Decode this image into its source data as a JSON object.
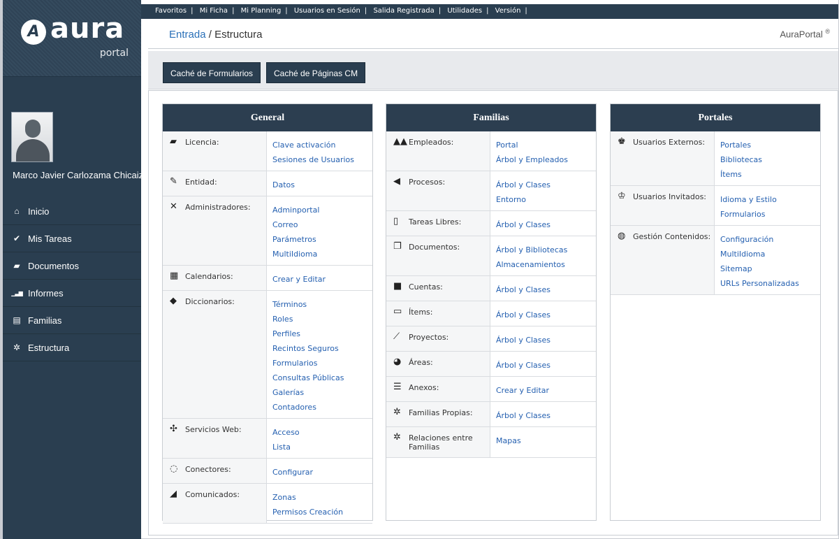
{
  "logo": {
    "mark": "A",
    "word": "aura",
    "sub": "portal"
  },
  "user": {
    "name": "Marco Javier Carlozama Chicaiza"
  },
  "nav": [
    {
      "icon": "home-icon",
      "glyph": "⌂",
      "label": "Inicio"
    },
    {
      "icon": "check-icon",
      "glyph": "✔",
      "label": "Mis Tareas"
    },
    {
      "icon": "folder-icon",
      "glyph": "▰",
      "label": "Documentos"
    },
    {
      "icon": "bar-chart-icon",
      "glyph": "▁▃▆",
      "label": "Informes"
    },
    {
      "icon": "list-icon",
      "glyph": "▤",
      "label": "Familias"
    },
    {
      "icon": "gear-icon",
      "glyph": "✲",
      "label": "Estructura"
    }
  ],
  "topbar": [
    "Favoritos",
    "Mi Ficha",
    "Mi Planning",
    "Usuarios en Sesión",
    "Salida Registrada",
    "Utilidades",
    "Versión"
  ],
  "breadcrumb": {
    "root": "Entrada",
    "sep": " / ",
    "current": "Estructura"
  },
  "brand": {
    "name": "AuraPortal",
    "mark": "®"
  },
  "toolbar": {
    "btn1": "Caché de Formularios",
    "btn2": "Caché de Páginas CM"
  },
  "panels": {
    "general": {
      "title": "General",
      "rows": [
        {
          "icon": "lock-icon",
          "glyph": "▰",
          "label": "Licencia:",
          "links": [
            "Clave activación",
            "Sesiones de Usuarios"
          ]
        },
        {
          "icon": "edit-icon",
          "glyph": "✎",
          "label": "Entidad:",
          "links": [
            "Datos"
          ]
        },
        {
          "icon": "tools-icon",
          "glyph": "✕",
          "label": "Administradores:",
          "links": [
            "Adminportal",
            "Correo",
            "Parámetros",
            "MultiIdioma"
          ]
        },
        {
          "icon": "calendar-icon",
          "glyph": "▦",
          "label": "Calendarios:",
          "links": [
            "Crear y Editar"
          ]
        },
        {
          "icon": "book-icon",
          "glyph": "◆",
          "label": "Diccionarios:",
          "links": [
            "Términos",
            "Roles",
            "Perfiles",
            "Recintos Seguros",
            "Formularios",
            "Consultas Públicas",
            "Galerías",
            "Contadores"
          ]
        },
        {
          "icon": "arrows-icon",
          "glyph": "✣",
          "label": "Servicios Web:",
          "links": [
            "Acceso",
            "Lista"
          ]
        },
        {
          "icon": "connector-icon",
          "glyph": "◌",
          "label": "Conectores:",
          "links": [
            "Configurar"
          ]
        },
        {
          "icon": "rss-icon",
          "glyph": "◢",
          "label": "Comunicados:",
          "links": [
            "Zonas",
            "Permisos Creación"
          ]
        }
      ]
    },
    "familias": {
      "title": "Familias",
      "rows": [
        {
          "icon": "users-icon",
          "glyph": "▲▲",
          "label": "Empleados:",
          "links": [
            "Portal",
            "Árbol y Empleados"
          ]
        },
        {
          "icon": "process-icon",
          "glyph": "◀",
          "label": "Procesos:",
          "links": [
            "Árbol y Clases",
            "Entorno"
          ]
        },
        {
          "icon": "clipboard-icon",
          "glyph": "▯",
          "label": "Tareas Libres:",
          "links": [
            "Árbol y Clases"
          ]
        },
        {
          "icon": "documents-icon",
          "glyph": "❐",
          "label": "Documentos:",
          "links": [
            "Árbol y Bibliotecas",
            "Almacenamientos"
          ]
        },
        {
          "icon": "account-icon",
          "glyph": "■",
          "label": "Cuentas:",
          "links": [
            "Árbol y Clases"
          ]
        },
        {
          "icon": "monitor-icon",
          "glyph": "▭",
          "label": "Ítems:",
          "links": [
            "Árbol y Clases"
          ]
        },
        {
          "icon": "project-icon",
          "glyph": "⟋",
          "label": "Proyectos:",
          "links": [
            "Árbol y Clases"
          ]
        },
        {
          "icon": "pie-icon",
          "glyph": "◕",
          "label": "Áreas:",
          "links": [
            "Árbol y Clases"
          ]
        },
        {
          "icon": "attachment-icon",
          "glyph": "☰",
          "label": "Anexos:",
          "links": [
            "Crear y Editar"
          ]
        },
        {
          "icon": "gear-icon",
          "glyph": "✲",
          "label": "Familias Propias:",
          "links": [
            "Árbol y Clases"
          ]
        },
        {
          "icon": "relations-icon",
          "glyph": "✲",
          "label": "Relaciones entre Familias",
          "links": [
            "Mapas"
          ]
        }
      ]
    },
    "portales": {
      "title": "Portales",
      "rows": [
        {
          "icon": "external-users-icon",
          "glyph": "♚",
          "label": "Usuarios Externos:",
          "links": [
            "Portales",
            "Bibliotecas",
            "Ítems"
          ]
        },
        {
          "icon": "guest-users-icon",
          "glyph": "♔",
          "label": "Usuarios Invitados:",
          "links": [
            "Idioma y Estilo",
            "Formularios"
          ]
        },
        {
          "icon": "globe-icon",
          "glyph": "◍",
          "label": "Gestión Contenidos:",
          "links": [
            "Configuración",
            "MultiIdioma",
            "Sitemap",
            "URLs Personalizadas"
          ]
        }
      ]
    }
  }
}
